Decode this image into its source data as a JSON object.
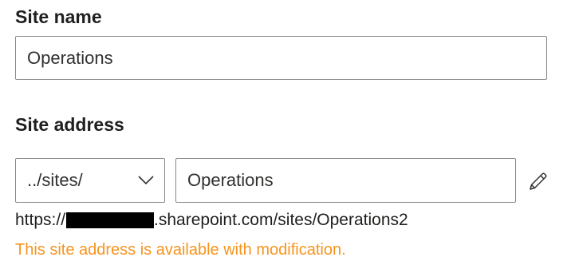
{
  "site_name": {
    "label": "Site name",
    "value": "Operations"
  },
  "site_address": {
    "label": "Site address",
    "path_prefix": "../sites/",
    "value": "Operations",
    "dropdown_icon": "chevron-down-icon",
    "edit_icon": "pencil-icon"
  },
  "url_preview": {
    "prefix": "https://",
    "suffix": ".sharepoint.com/sites/Operations2"
  },
  "status": {
    "message": "This site address is available with modification.",
    "color": "#f7941d"
  }
}
